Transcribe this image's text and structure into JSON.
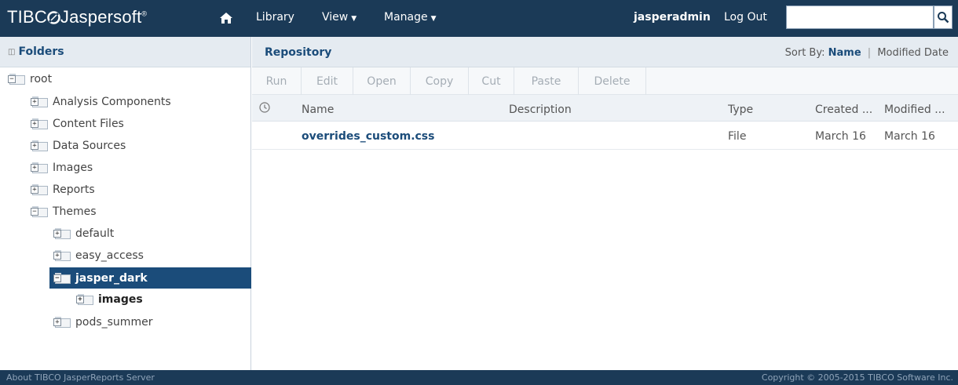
{
  "topbar": {
    "logo": "TIBC",
    "logo_rest": "Jaspersoft",
    "logo_reg": "®",
    "nav": {
      "library": "Library",
      "view": "View",
      "manage": "Manage"
    },
    "user": "jasperadmin",
    "logout": "Log Out",
    "search_value": ""
  },
  "folders": {
    "title": "Folders",
    "nodes": [
      {
        "label": "root",
        "toggle": "−"
      },
      {
        "label": "Analysis Components",
        "toggle": "+"
      },
      {
        "label": "Content Files",
        "toggle": "+"
      },
      {
        "label": "Data Sources",
        "toggle": "+"
      },
      {
        "label": "Images",
        "toggle": "+"
      },
      {
        "label": "Reports",
        "toggle": "+"
      },
      {
        "label": "Themes",
        "toggle": "−"
      },
      {
        "label": "default",
        "toggle": "+"
      },
      {
        "label": "easy_access",
        "toggle": "+"
      },
      {
        "label": "jasper_dark",
        "toggle": "−"
      },
      {
        "label": "images",
        "toggle": "+"
      },
      {
        "label": "pods_summer",
        "toggle": "+"
      }
    ]
  },
  "repository": {
    "title": "Repository",
    "sort_label": "Sort By:",
    "sort_name": "Name",
    "sort_sep": "|",
    "sort_modified": "Modified Date",
    "toolbar": {
      "run": "Run",
      "edit": "Edit",
      "open": "Open",
      "copy": "Copy",
      "cut": "Cut",
      "paste": "Paste",
      "delete": "Delete"
    },
    "columns": {
      "name": "Name",
      "description": "Description",
      "type": "Type",
      "created": "Created ...",
      "modified": "Modified ..."
    },
    "rows": [
      {
        "name": "overrides_custom.css",
        "description": "",
        "type": "File",
        "created": "March 16",
        "modified": "March 16"
      }
    ]
  },
  "footer": {
    "about": "About TIBCO JasperReports Server",
    "copyright": "Copyright © 2005-2015 TIBCO Software Inc."
  },
  "colors": {
    "topbar": "#1b3a57",
    "accent": "#1b4c7a",
    "header_bg": "#e5ebf1"
  }
}
